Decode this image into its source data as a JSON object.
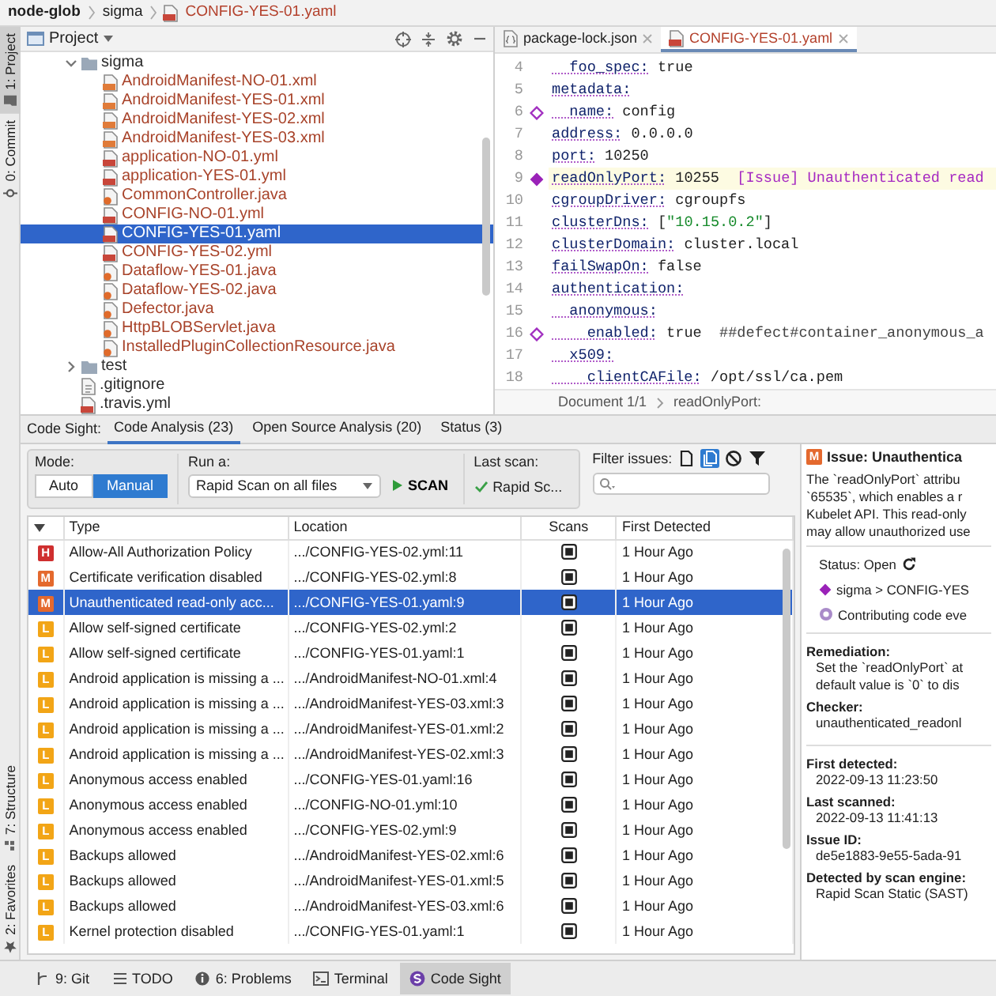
{
  "breadcrumb": [
    {
      "label": "node-glob",
      "kind": "project"
    },
    {
      "label": "sigma",
      "kind": "folder"
    },
    {
      "label": "CONFIG-YES-01.yaml",
      "kind": "yml"
    }
  ],
  "tool_strip": {
    "top": [
      {
        "label": "1: Project",
        "selected": true
      },
      {
        "label": "0: Commit",
        "selected": false
      }
    ],
    "bottom": [
      {
        "label": "7: Structure",
        "selected": false
      },
      {
        "label": "2: Favorites",
        "selected": false
      }
    ]
  },
  "project": {
    "title": "Project",
    "tree": [
      {
        "label": "sigma",
        "kind": "folder",
        "expanded": true,
        "selected": false,
        "color": "#2b2b2b",
        "children": [
          {
            "label": "AndroidManifest-NO-01.xml",
            "kind": "xml",
            "selected": false,
            "color": "#a8432a"
          },
          {
            "label": "AndroidManifest-YES-01.xml",
            "kind": "xml",
            "selected": false,
            "color": "#a8432a"
          },
          {
            "label": "AndroidManifest-YES-02.xml",
            "kind": "xml",
            "selected": false,
            "color": "#a8432a"
          },
          {
            "label": "AndroidManifest-YES-03.xml",
            "kind": "xml",
            "selected": false,
            "color": "#a8432a"
          },
          {
            "label": "application-NO-01.yml",
            "kind": "yml",
            "selected": false,
            "color": "#a8432a"
          },
          {
            "label": "application-YES-01.yml",
            "kind": "yml",
            "selected": false,
            "color": "#a8432a"
          },
          {
            "label": "CommonController.java",
            "kind": "java",
            "selected": false,
            "color": "#a8432a"
          },
          {
            "label": "CONFIG-NO-01.yml",
            "kind": "yml",
            "selected": false,
            "color": "#a8432a"
          },
          {
            "label": "CONFIG-YES-01.yaml",
            "kind": "yml",
            "selected": true
          },
          {
            "label": "CONFIG-YES-02.yml",
            "kind": "yml",
            "selected": false,
            "color": "#a8432a"
          },
          {
            "label": "Dataflow-YES-01.java",
            "kind": "java",
            "selected": false,
            "color": "#a8432a"
          },
          {
            "label": "Dataflow-YES-02.java",
            "kind": "java",
            "selected": false,
            "color": "#a8432a"
          },
          {
            "label": "Defector.java",
            "kind": "java",
            "selected": false,
            "color": "#a8432a"
          },
          {
            "label": "HttpBLOBServlet.java",
            "kind": "java",
            "selected": false,
            "color": "#a8432a"
          },
          {
            "label": "InstalledPluginCollectionResource.java",
            "kind": "java",
            "selected": false,
            "color": "#a8432a"
          }
        ]
      },
      {
        "label": "test",
        "kind": "folder",
        "expanded": false,
        "selected": false,
        "color": "#2b2b2b"
      },
      {
        "label": ".gitignore",
        "kind": "text",
        "selected": false,
        "color": "#2b2b2b"
      },
      {
        "label": ".travis.yml",
        "kind": "yml",
        "selected": false,
        "color": "#2b2b2b"
      }
    ]
  },
  "editor": {
    "tabs": [
      {
        "label": "package-lock.json",
        "kind": "json",
        "selected": false
      },
      {
        "label": "CONFIG-YES-01.yaml",
        "kind": "yml",
        "selected": true
      }
    ],
    "lines": [
      {
        "number": "4",
        "highlighted": false,
        "segments": [
          {
            "kind": "key",
            "text": "  foo_spec:"
          },
          {
            "kind": "plain",
            "text": " true"
          }
        ]
      },
      {
        "number": "5",
        "highlighted": false,
        "segments": [
          {
            "kind": "key",
            "text": "metadata:"
          }
        ]
      },
      {
        "number": "6",
        "highlighted": false,
        "kind": "marked",
        "segments": [
          {
            "kind": "key",
            "text": "  name:"
          },
          {
            "kind": "plain",
            "text": " config"
          }
        ]
      },
      {
        "number": "7",
        "highlighted": false,
        "segments": [
          {
            "kind": "key",
            "text": "address:"
          },
          {
            "kind": "plain",
            "text": " 0.0.0.0"
          }
        ]
      },
      {
        "number": "8",
        "highlighted": false,
        "segments": [
          {
            "kind": "key",
            "text": "port:"
          },
          {
            "kind": "plain",
            "text": " 10250"
          }
        ]
      },
      {
        "number": "9",
        "highlighted": true,
        "kind": "focused",
        "segments": [
          {
            "kind": "key",
            "text": "readOnlyPort:"
          },
          {
            "kind": "plain",
            "text": " 10255"
          },
          {
            "kind": "issue",
            "text": "  [Issue] Unauthenticated read"
          }
        ]
      },
      {
        "number": "10",
        "highlighted": false,
        "segments": [
          {
            "kind": "key",
            "text": "cgroupDriver:"
          },
          {
            "kind": "plain",
            "text": " cgroupfs"
          }
        ]
      },
      {
        "number": "11",
        "highlighted": false,
        "segments": [
          {
            "kind": "key",
            "text": "clusterDns:"
          },
          {
            "kind": "plain",
            "text": " ["
          },
          {
            "kind": "string",
            "text": "\"10.15.0.2\""
          },
          {
            "kind": "plain",
            "text": "]"
          }
        ]
      },
      {
        "number": "12",
        "highlighted": false,
        "segments": [
          {
            "kind": "key",
            "text": "clusterDomain:"
          },
          {
            "kind": "plain",
            "text": " cluster.local"
          }
        ]
      },
      {
        "number": "13",
        "highlighted": false,
        "segments": [
          {
            "kind": "key",
            "text": "failSwapOn:"
          },
          {
            "kind": "plain",
            "text": " false"
          }
        ]
      },
      {
        "number": "14",
        "highlighted": false,
        "segments": [
          {
            "kind": "key",
            "text": "authentication:"
          }
        ]
      },
      {
        "number": "15",
        "highlighted": false,
        "segments": [
          {
            "kind": "key",
            "text": "  anonymous:"
          }
        ]
      },
      {
        "number": "16",
        "highlighted": false,
        "kind": "marked",
        "segments": [
          {
            "kind": "key",
            "text": "    enabled:"
          },
          {
            "kind": "plain",
            "text": " true"
          },
          {
            "kind": "comment",
            "text": "  ##defect#container_anonymous_a"
          }
        ]
      },
      {
        "number": "17",
        "highlighted": false,
        "segments": [
          {
            "kind": "key",
            "text": "  x509:"
          }
        ]
      },
      {
        "number": "18",
        "highlighted": false,
        "segments": [
          {
            "kind": "key",
            "text": "    clientCAFile:"
          },
          {
            "kind": "plain",
            "text": " /opt/ssl/ca.pem"
          }
        ]
      }
    ],
    "breadcrumb": [
      "Document 1/1",
      "readOnlyPort:"
    ]
  },
  "code_sight": {
    "label": "Code Sight:",
    "tabs": [
      {
        "label": "Code Analysis (23)",
        "selected": true
      },
      {
        "label": "Open Source Analysis (20)",
        "selected": false
      },
      {
        "label": "Status (3)",
        "selected": false
      }
    ],
    "mode": {
      "label": "Mode:",
      "options": [
        {
          "label": "Auto",
          "selected": false
        },
        {
          "label": "Manual",
          "selected": true
        }
      ]
    },
    "run": {
      "label": "Run a:",
      "value": "Rapid Scan on all files",
      "button": "SCAN"
    },
    "last_scan": {
      "label": "Last scan:",
      "value": "Rapid Sc..."
    },
    "filter": {
      "label": "Filter issues:",
      "toggles": [
        {
          "selected": false
        },
        {
          "selected": true
        },
        {
          "selected": false
        },
        {
          "selected": false
        }
      ]
    },
    "table": {
      "columns": [
        "Type",
        "Location",
        "Scans",
        "First Detected"
      ],
      "rows": [
        {
          "severity": "H",
          "color": "#cf2f2f",
          "type": "Allow-All Authorization Policy",
          "location": ".../CONFIG-YES-02.yml:11",
          "first_detected": "1 Hour Ago",
          "selected": false
        },
        {
          "severity": "M",
          "color": "#e4692e",
          "type": "Certificate verification disabled",
          "location": ".../CONFIG-YES-02.yml:8",
          "first_detected": "1 Hour Ago",
          "selected": false
        },
        {
          "severity": "M",
          "color": "#e4692e",
          "type": "Unauthenticated read-only acc...",
          "location": ".../CONFIG-YES-01.yaml:9",
          "first_detected": "1 Hour Ago",
          "selected": true
        },
        {
          "severity": "L",
          "color": "#f2a516",
          "type": "Allow self-signed certificate",
          "location": ".../CONFIG-YES-02.yml:2",
          "first_detected": "1 Hour Ago",
          "selected": false
        },
        {
          "severity": "L",
          "color": "#f2a516",
          "type": "Allow self-signed certificate",
          "location": ".../CONFIG-YES-01.yaml:1",
          "first_detected": "1 Hour Ago",
          "selected": false
        },
        {
          "severity": "L",
          "color": "#f2a516",
          "type": "Android application is missing a ...",
          "location": ".../AndroidManifest-NO-01.xml:4",
          "first_detected": "1 Hour Ago",
          "selected": false
        },
        {
          "severity": "L",
          "color": "#f2a516",
          "type": "Android application is missing a ...",
          "location": ".../AndroidManifest-YES-03.xml:3",
          "first_detected": "1 Hour Ago",
          "selected": false
        },
        {
          "severity": "L",
          "color": "#f2a516",
          "type": "Android application is missing a ...",
          "location": ".../AndroidManifest-YES-01.xml:2",
          "first_detected": "1 Hour Ago",
          "selected": false
        },
        {
          "severity": "L",
          "color": "#f2a516",
          "type": "Android application is missing a ...",
          "location": ".../AndroidManifest-YES-02.xml:3",
          "first_detected": "1 Hour Ago",
          "selected": false
        },
        {
          "severity": "L",
          "color": "#f2a516",
          "type": "Anonymous access enabled",
          "location": ".../CONFIG-YES-01.yaml:16",
          "first_detected": "1 Hour Ago",
          "selected": false
        },
        {
          "severity": "L",
          "color": "#f2a516",
          "type": "Anonymous access enabled",
          "location": ".../CONFIG-NO-01.yml:10",
          "first_detected": "1 Hour Ago",
          "selected": false
        },
        {
          "severity": "L",
          "color": "#f2a516",
          "type": "Anonymous access enabled",
          "location": ".../CONFIG-YES-02.yml:9",
          "first_detected": "1 Hour Ago",
          "selected": false
        },
        {
          "severity": "L",
          "color": "#f2a516",
          "type": "Backups allowed",
          "location": ".../AndroidManifest-YES-02.xml:6",
          "first_detected": "1 Hour Ago",
          "selected": false
        },
        {
          "severity": "L",
          "color": "#f2a516",
          "type": "Backups allowed",
          "location": ".../AndroidManifest-YES-01.xml:5",
          "first_detected": "1 Hour Ago",
          "selected": false
        },
        {
          "severity": "L",
          "color": "#f2a516",
          "type": "Backups allowed",
          "location": ".../AndroidManifest-YES-03.xml:6",
          "first_detected": "1 Hour Ago",
          "selected": false
        },
        {
          "severity": "L",
          "color": "#f2a516",
          "type": "Kernel protection disabled",
          "location": ".../CONFIG-YES-01.yaml:1",
          "first_detected": "1 Hour Ago",
          "selected": false
        }
      ]
    }
  },
  "details": {
    "severity": "M",
    "color": "#e4692e",
    "title": "Issue: Unauthentica",
    "description": [
      "The `readOnlyPort` attribu",
      "`65535`, which enables a r",
      "Kubelet API. This read-only",
      "may allow unauthorized use"
    ],
    "status": "Status: Open",
    "path": "sigma > CONFIG-YES",
    "contributing": "Contributing code eve",
    "sections": [
      {
        "heading": "Remediation:",
        "lines": [
          "Set the `readOnlyPort` at",
          "default value is `0` to dis"
        ]
      },
      {
        "heading": "Checker:",
        "lines": [
          "unauthenticated_readonl"
        ]
      },
      {
        "heading": "First detected:",
        "lines": [
          "2022-09-13 11:23:50"
        ]
      },
      {
        "heading": "Last scanned:",
        "lines": [
          "2022-09-13 11:41:13"
        ]
      },
      {
        "heading": "Issue ID:",
        "lines": [
          "de5e1883-9e55-5ada-91"
        ]
      },
      {
        "heading": "Detected by scan engine:",
        "lines": [
          "Rapid Scan Static (SAST)"
        ]
      }
    ]
  },
  "bottom_toolbar": [
    {
      "label": "9: Git",
      "selected": false
    },
    {
      "label": "TODO",
      "selected": false
    },
    {
      "label": "6: Problems",
      "selected": false
    },
    {
      "label": "Terminal",
      "selected": false
    },
    {
      "label": "Code Sight",
      "selected": true
    }
  ]
}
